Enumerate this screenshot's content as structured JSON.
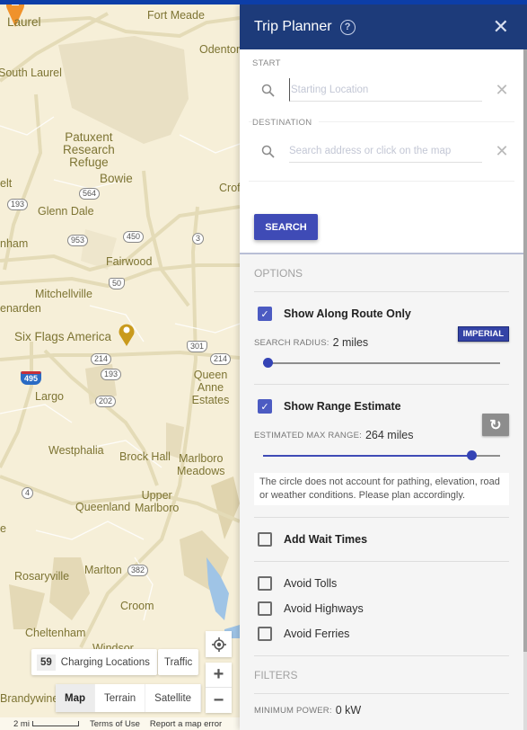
{
  "map": {
    "places": [
      {
        "name": "Fort Meade"
      },
      {
        "name": "Laurel"
      },
      {
        "name": "Odenton"
      },
      {
        "name": "South Laurel"
      },
      {
        "name": "Patuxent Research Refuge"
      },
      {
        "name": "Bowie"
      },
      {
        "name": "Glenn Dale"
      },
      {
        "name": "Crofton"
      },
      {
        "name": "Beltsville"
      },
      {
        "name": "Lanham"
      },
      {
        "name": "Fairwood"
      },
      {
        "name": "Mitchellville"
      },
      {
        "name": "Landover Hills / Glenarden"
      },
      {
        "name": "Six Flags America"
      },
      {
        "name": "Queen Anne Estates"
      },
      {
        "name": "Largo"
      },
      {
        "name": "Westphalia"
      },
      {
        "name": "Brock Hall"
      },
      {
        "name": "Marlboro Meadows"
      },
      {
        "name": "Upper Marlboro"
      },
      {
        "name": "Queenland"
      },
      {
        "name": "Rosaryville"
      },
      {
        "name": "Marlton"
      },
      {
        "name": "Croom"
      },
      {
        "name": "Cheltenham"
      },
      {
        "name": "Windsor"
      },
      {
        "name": "Brandywine"
      }
    ],
    "labels": {
      "fort_meade": "Fort Meade",
      "laurel": "Laurel",
      "odenton": "Odenton",
      "south_laurel": "South Laurel",
      "patuxent": "Patuxent\nResearch\nRefuge",
      "bowie": "Bowie",
      "glenn_dale": "Glenn Dale",
      "crofton": "Crof",
      "beltsville": "elt",
      "lanham": "nham",
      "fairwood": "Fairwood",
      "mitchellville": "Mitchellville",
      "glenarden": "enarden",
      "six_flags": "Six Flags America",
      "queen_anne": "Queen Anne\nEstates",
      "largo": "Largo",
      "westphalia": "Westphalia",
      "brock_hall": "Brock Hall",
      "marlboro_meadows": "Marlboro\nMeadows",
      "upper_marlboro": "Upper\nMarlboro",
      "queenland": "Queenland",
      "rosaryville": "Rosaryville",
      "marlton": "Marlton",
      "croom": "Croom",
      "cheltenham": "Cheltenham",
      "windsor": "Windsor",
      "brandywine": "Brandywine",
      "estates_fragment": "e"
    },
    "route_shields": {
      "r564": "564",
      "r193a": "193",
      "r953": "953",
      "r450": "450",
      "r3": "3",
      "r50": "50",
      "r301": "301",
      "r214a": "214",
      "r214b": "214",
      "r193b": "193",
      "r202": "202",
      "r495": "495",
      "r4": "4",
      "r382": "382"
    },
    "controls": {
      "charging_count": "59",
      "charging_label": "Charging Locations",
      "traffic_label": "Traffic",
      "map_types": [
        "Map",
        "Terrain",
        "Satellite"
      ],
      "active_map_type": "Map",
      "zoom_in": "+",
      "zoom_out": "−"
    },
    "footer": {
      "scale_label": "2 mi",
      "terms": "Terms of Use",
      "report": "Report a map error"
    }
  },
  "panel": {
    "title": "Trip Planner",
    "help_glyph": "?",
    "close_glyph": "✕",
    "start": {
      "label": "START",
      "placeholder": "Starting Location",
      "value": ""
    },
    "destination": {
      "label": "DESTINATION",
      "placeholder": "Search address or click on the map",
      "value": ""
    },
    "clear_glyph": "✕",
    "search_button": "SEARCH",
    "options": {
      "heading": "OPTIONS",
      "show_along_route": {
        "label": "Show Along Route Only",
        "checked": true
      },
      "search_radius": {
        "key": "SEARCH RADIUS:",
        "value": "2 miles",
        "slider_fraction": 0.02
      },
      "units_button": "IMPERIAL",
      "show_range": {
        "label": "Show Range Estimate",
        "checked": true
      },
      "max_range": {
        "key": "ESTIMATED MAX RANGE:",
        "value": "264 miles",
        "slider_fraction": 0.88
      },
      "refresh_glyph": "↻",
      "range_note": "The circle does not account for pathing, elevation, road or weather conditions. Please plan accordingly.",
      "add_wait_times": {
        "label": "Add Wait Times",
        "checked": false
      },
      "avoid": [
        {
          "label": "Avoid Tolls",
          "checked": false
        },
        {
          "label": "Avoid Highways",
          "checked": false
        },
        {
          "label": "Avoid Ferries",
          "checked": false
        }
      ]
    },
    "filters": {
      "heading": "FILTERS",
      "min_power": {
        "key": "MINIMUM POWER:",
        "value": "0 kW"
      }
    }
  },
  "colors": {
    "header_bg": "#1d3b7a",
    "accent": "#3f4bb6",
    "top_bar": "#0c3ea8",
    "pin_orange": "#f0922b",
    "pin_gold": "#c99a1c"
  }
}
